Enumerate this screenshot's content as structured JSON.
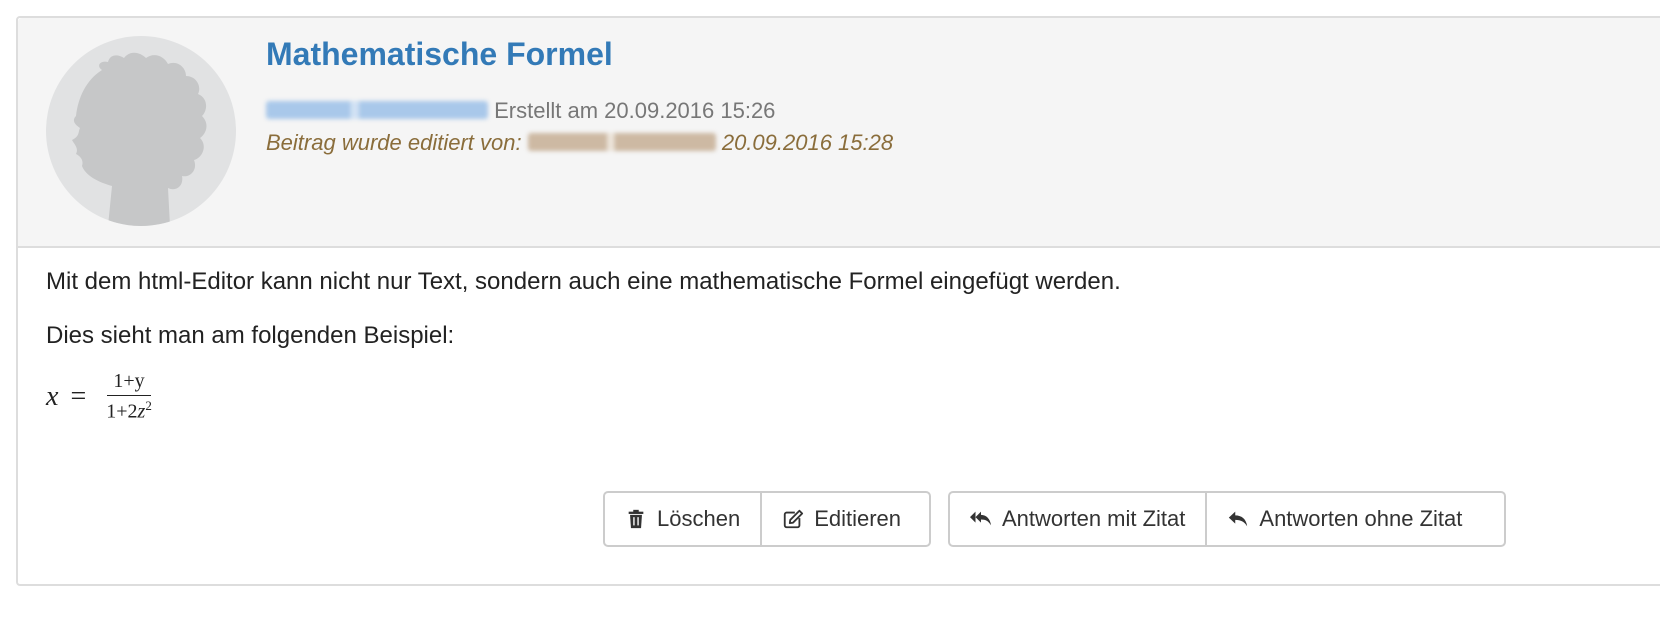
{
  "post": {
    "title": "Mathematische Formel",
    "created_text": "Erstellt am 20.09.2016 15:26",
    "edited_prefix": "Beitrag wurde editiert von:",
    "edited_date": "20.09.2016 15:28"
  },
  "content": {
    "paragraph1": "Mit dem html-Editor kann nicht nur Text, sondern auch eine mathematische Formel eingefügt werden.",
    "paragraph2": "Dies sieht man am folgenden Beispiel:",
    "formula": {
      "lhs": "x",
      "eq": "=",
      "numerator": "1+y",
      "denominator_prefix": "1+2",
      "denominator_var": "z",
      "denominator_exp": "2"
    }
  },
  "actions": {
    "delete_label": "Löschen",
    "edit_label": "Editieren",
    "reply_quote_label": "Antworten mit Zitat",
    "reply_label": "Antworten ohne Zitat"
  },
  "icons": {
    "avatar": "avatar-placeholder-icon",
    "delete": "trash-icon",
    "edit": "edit-icon",
    "reply_quote": "reply-all-icon",
    "reply": "reply-icon"
  },
  "colors": {
    "title": "#337ab7",
    "edited": "#8a6d3b",
    "header_bg": "#f5f5f5",
    "border": "#dddddd"
  }
}
